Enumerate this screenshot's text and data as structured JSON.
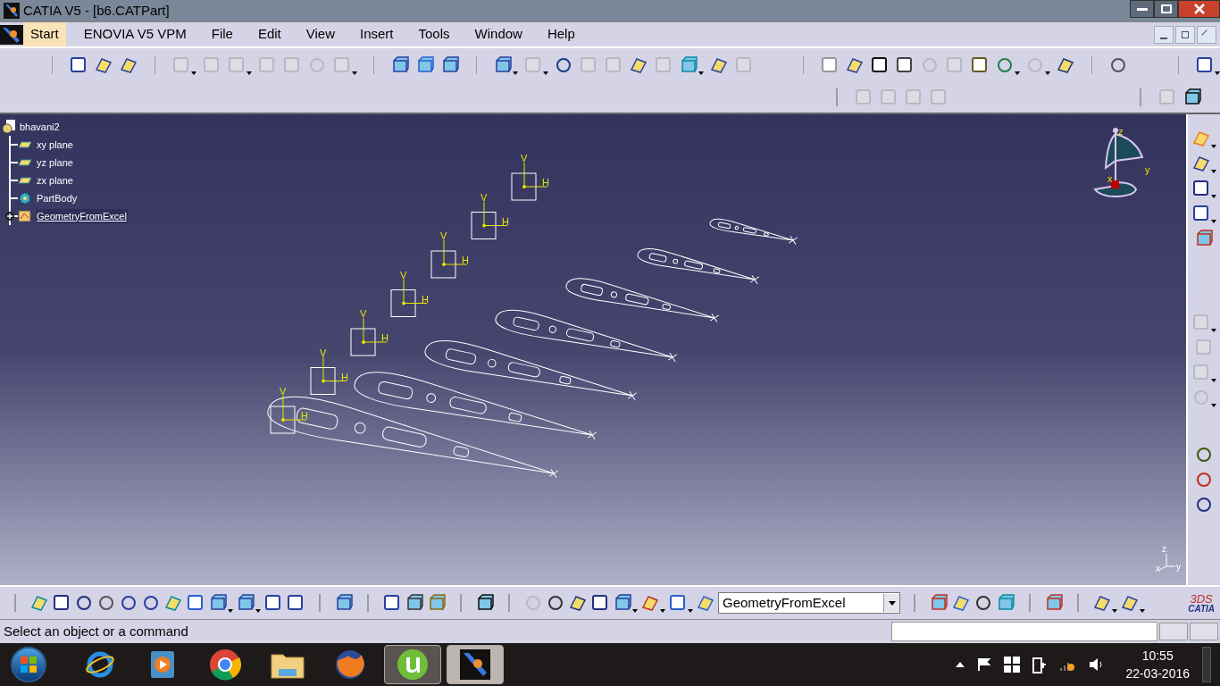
{
  "window": {
    "title": "CATIA V5 - [b6.CATPart]"
  },
  "menu": [
    {
      "label": "Start",
      "selected": true
    },
    {
      "label": "ENOVIA V5 VPM",
      "selected": false
    },
    {
      "label": "File",
      "selected": false
    },
    {
      "label": "Edit",
      "selected": false
    },
    {
      "label": "View",
      "selected": false
    },
    {
      "label": "Insert",
      "selected": false
    },
    {
      "label": "Tools",
      "selected": false
    },
    {
      "label": "Window",
      "selected": false
    },
    {
      "label": "Help",
      "selected": false
    }
  ],
  "tree": {
    "root": "bhavani2",
    "children": [
      {
        "label": "xy plane",
        "kind": "plane",
        "expandable": false,
        "selected": false
      },
      {
        "label": "yz plane",
        "kind": "plane",
        "expandable": false,
        "selected": false
      },
      {
        "label": "zx plane",
        "kind": "plane",
        "expandable": false,
        "selected": false
      },
      {
        "label": "PartBody",
        "kind": "body",
        "expandable": false,
        "selected": false
      },
      {
        "label": "GeometryFromExcel",
        "kind": "geoset",
        "expandable": true,
        "selected": true
      }
    ]
  },
  "sketches": [
    {
      "v": "V",
      "h": "H"
    },
    {
      "v": "V",
      "h": "H"
    },
    {
      "v": "V",
      "h": "H"
    },
    {
      "v": "V",
      "h": "H"
    },
    {
      "v": "V",
      "h": "H"
    },
    {
      "v": "V",
      "h": "H"
    },
    {
      "v": "V",
      "h": "H"
    }
  ],
  "compass": {
    "z": "z",
    "y": "y",
    "x": "x"
  },
  "axis_triad": {
    "z": "z",
    "x": "x",
    "y": "y"
  },
  "layer_select": {
    "value": "GeometryFromExcel"
  },
  "logo": {
    "mark": "3DS",
    "text": "CATIA"
  },
  "status_bar": {
    "message": "Select an object or a command"
  },
  "taskbar": {
    "apps": [
      {
        "kind": "ie",
        "running": false,
        "selected": false
      },
      {
        "kind": "media",
        "running": false,
        "selected": false
      },
      {
        "kind": "chrome",
        "running": false,
        "selected": false
      },
      {
        "kind": "explorer",
        "running": false,
        "selected": false
      },
      {
        "kind": "firefox",
        "running": false,
        "selected": false
      },
      {
        "kind": "utorrent",
        "running": true,
        "selected": false
      },
      {
        "kind": "catia",
        "running": true,
        "selected": true
      }
    ],
    "time": "10:55",
    "date": "22-03-2016"
  }
}
